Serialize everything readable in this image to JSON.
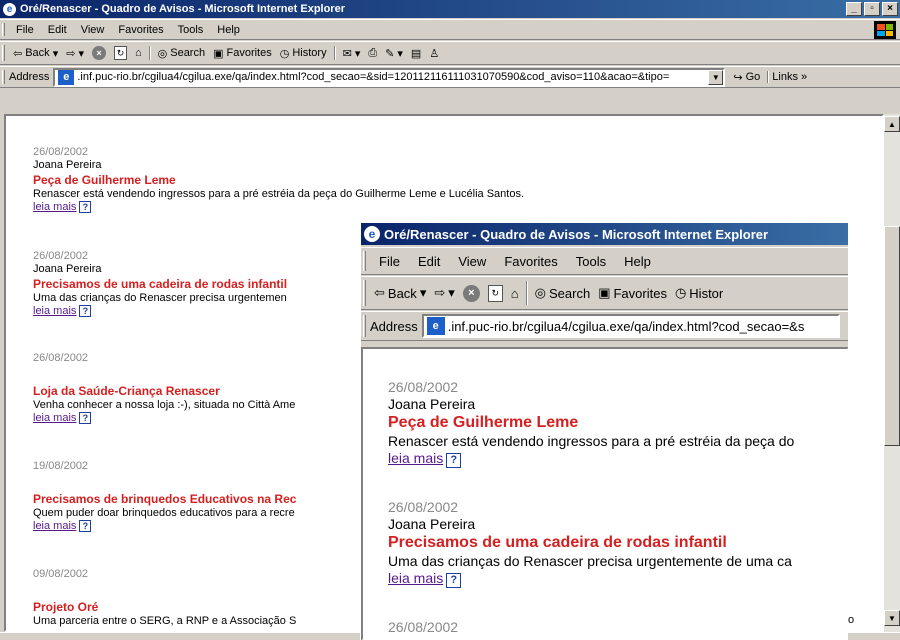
{
  "back_window": {
    "title": "Oré/Renascer - Quadro de Avisos - Microsoft Internet Explorer",
    "menu": [
      "File",
      "Edit",
      "View",
      "Favorites",
      "Tools",
      "Help"
    ],
    "toolbar": {
      "back": "Back",
      "search": "Search",
      "favorites": "Favorites",
      "history": "History"
    },
    "address_label": "Address",
    "url": ".inf.puc-rio.br/cgilua4/cgilua.exe/qa/index.html?cod_secao=&sid=120112116111031070590&cod_aviso=110&acao=&tipo=",
    "go_label": "Go",
    "links_label": "Links",
    "notices": [
      {
        "date": "26/08/2002",
        "author": "Joana Pereira",
        "title": "Peça de Guilherme Leme",
        "text": "Renascer está vendendo ingressos para a pré estréia da peça do Guilherme Leme e Lucélia Santos.",
        "link": "leia mais"
      },
      {
        "date": "26/08/2002",
        "author": "Joana Pereira",
        "title": "Precisamos de uma cadeira de rodas infantil",
        "text": "Uma das crianças do Renascer precisa urgentemen",
        "link": "leia mais"
      },
      {
        "date": "26/08/2002",
        "author": "",
        "title": "Loja da Saúde-Criança Renascer",
        "text": "Venha conhecer a nossa loja :-), situada no Città Ame",
        "link": "leia mais"
      },
      {
        "date": "19/08/2002",
        "author": "",
        "title": "Precisamos de brinquedos Educativos na Rec",
        "text": "Quem puder doar brinquedos educativos para a recre",
        "link": "leia mais"
      },
      {
        "date": "09/08/2002",
        "author": "",
        "title": "Projeto Oré",
        "text": "Uma parceria entre o SERG, a RNP e a Associação S",
        "link": ""
      }
    ],
    "partial_right_text": "o"
  },
  "front_window": {
    "title": "Oré/Renascer - Quadro de Avisos - Microsoft Internet Explorer",
    "menu": [
      "File",
      "Edit",
      "View",
      "Favorites",
      "Tools",
      "Help"
    ],
    "toolbar": {
      "back": "Back",
      "search": "Search",
      "favorites": "Favorites",
      "history": "Histor"
    },
    "address_label": "Address",
    "url": ".inf.puc-rio.br/cgilua4/cgilua.exe/qa/index.html?cod_secao=&s",
    "notices": [
      {
        "date": "26/08/2002",
        "author": "Joana Pereira",
        "title": "Peça de Guilherme Leme",
        "text": "Renascer está vendendo ingressos para a pré estréia da peça do",
        "link": "leia mais"
      },
      {
        "date": "26/08/2002",
        "author": "Joana Pereira",
        "title": "Precisamos de uma cadeira de rodas infantil",
        "text": "Uma das crianças do Renascer precisa urgentemente de uma ca",
        "link": "leia mais"
      },
      {
        "date": "26/08/2002",
        "author": "",
        "title": "",
        "text": "",
        "link": ""
      }
    ]
  },
  "icons": {
    "ie": "e",
    "help": "?",
    "stop": "×",
    "back_arrow": "⇦",
    "fwd_arrow": "⇨"
  }
}
